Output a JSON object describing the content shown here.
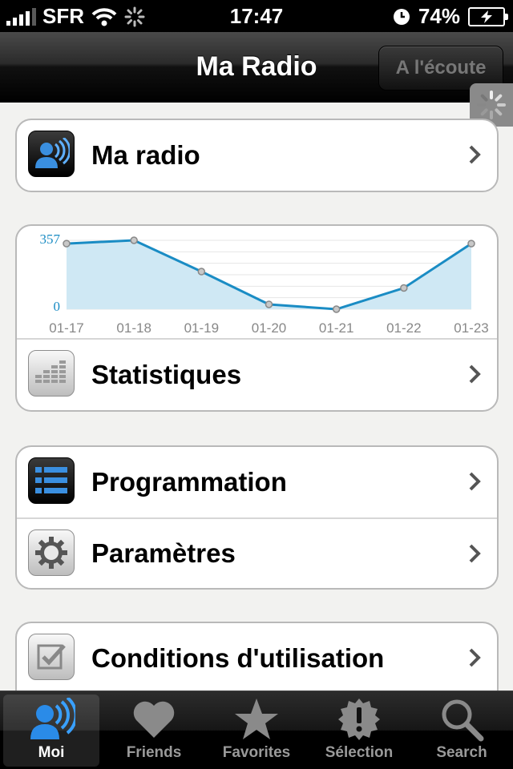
{
  "status_bar": {
    "carrier": "SFR",
    "time": "17:47",
    "battery": "74%"
  },
  "navbar": {
    "title": "Ma Radio",
    "listen_button": "A l'écoute"
  },
  "sections": {
    "radio": {
      "label": "Ma radio",
      "icon": "radio-user-icon"
    },
    "stats": {
      "label": "Statistiques",
      "icon": "equalizer-icon"
    },
    "programming": {
      "label": "Programmation",
      "icon": "list-icon"
    },
    "settings": {
      "label": "Paramètres",
      "icon": "gear-icon"
    },
    "terms": {
      "label": "Conditions d'utilisation",
      "icon": "checkbox-icon"
    }
  },
  "chart_data": {
    "type": "area",
    "x": [
      "01-17",
      "01-18",
      "01-19",
      "01-20",
      "01-21",
      "01-22",
      "01-23"
    ],
    "series": [
      {
        "values": [
          340,
          357,
          195,
          25,
          0,
          110,
          340
        ]
      }
    ],
    "ylim": [
      0,
      357
    ],
    "y_tick_labels": [
      "357",
      "0"
    ],
    "grid": true,
    "color": "#1a8cc4",
    "fill": "#cfe8f4"
  },
  "tabbar": {
    "tabs": [
      {
        "label": "Moi",
        "icon": "radio-user-icon",
        "active": true
      },
      {
        "label": "Friends",
        "icon": "heart-icon",
        "active": false
      },
      {
        "label": "Favorites",
        "icon": "star-icon",
        "active": false
      },
      {
        "label": "Sélection",
        "icon": "badge-exclamation-icon",
        "active": false
      },
      {
        "label": "Search",
        "icon": "search-icon",
        "active": false
      }
    ]
  }
}
